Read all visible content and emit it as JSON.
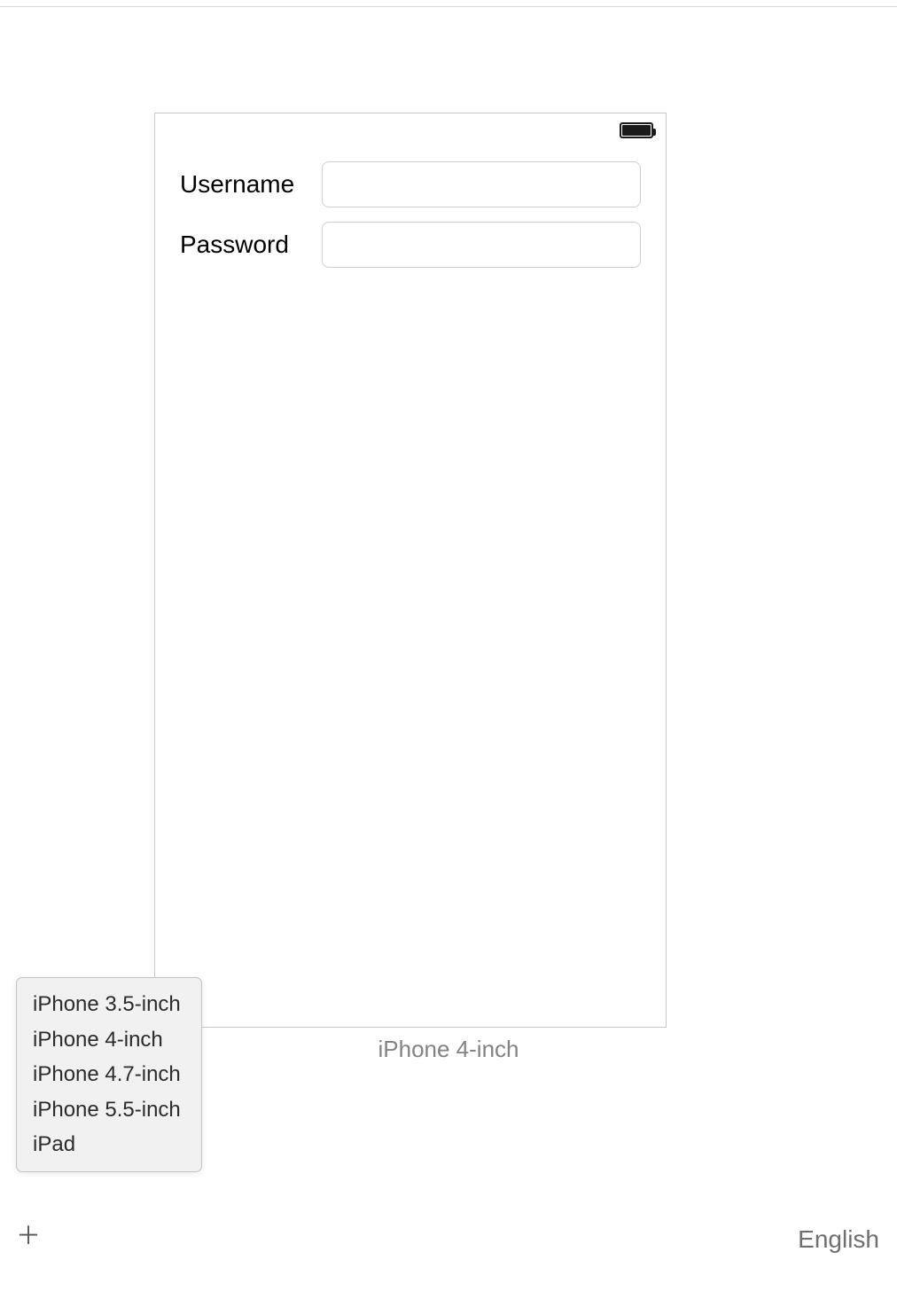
{
  "form": {
    "username_label": "Username",
    "username_value": "",
    "password_label": "Password",
    "password_value": ""
  },
  "device_preview": {
    "current_label": "iPhone 4-inch"
  },
  "device_menu": {
    "items": [
      "iPhone 3.5-inch",
      "iPhone 4-inch",
      "iPhone 4.7-inch",
      "iPhone 5.5-inch",
      "iPad"
    ]
  },
  "toolbar": {
    "plus_symbol": "＋",
    "language": "English"
  }
}
